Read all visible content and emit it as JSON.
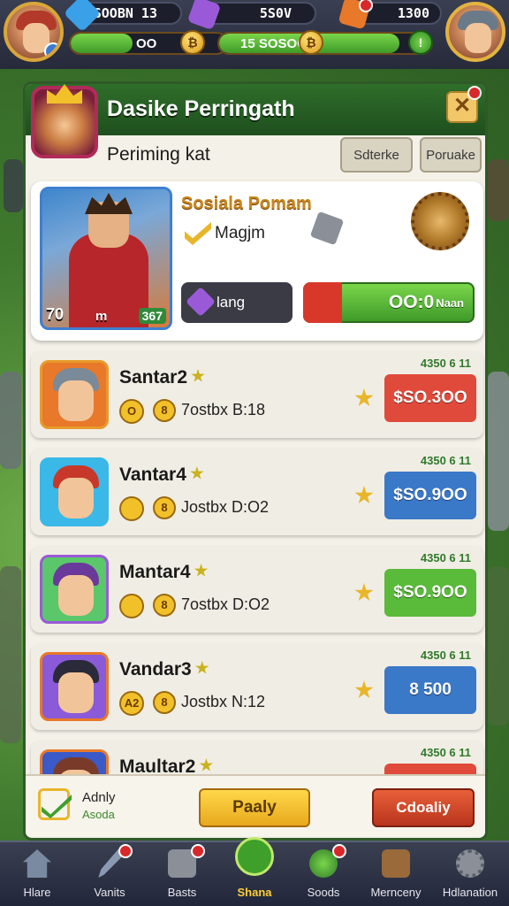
{
  "topbar": {
    "resource1": "SOOBN 13",
    "resource2": "5S0V",
    "resource3": "1300",
    "bar_left_value": "OO",
    "bar_mid_value": "15 SOSOO",
    "bar_left_fill": 0.4,
    "bar_right_fill": 0.85
  },
  "panel": {
    "title": "Dasike Perringath",
    "subtitle": "Periming kat",
    "tab1": "Sdterke",
    "tab2": "Poruake",
    "close_label": "✕"
  },
  "featured": {
    "level": "70",
    "mid_label": "m",
    "power": "367",
    "title": "Sosiala Pomam",
    "subtitle": "Magjm",
    "dark_button_label": "lang",
    "green_button_label": "OO:0",
    "green_button_suffix": "Naan"
  },
  "rows": [
    {
      "name": "Santar2",
      "id": "4350 6 11",
      "icon1": "O",
      "icon2": "8",
      "stat": "7ostbx  B:18",
      "price": "$SO.3OO",
      "btn_color": "#e04a3a"
    },
    {
      "name": "Vantar4",
      "id": "4350 6 11",
      "icon1": "",
      "icon2": "8",
      "stat": "Jostbx  D:O2",
      "price": "$SO.9OO",
      "btn_color": "#3a78c8"
    },
    {
      "name": "Mantar4",
      "id": "4350 6 11",
      "icon1": "",
      "icon2": "8",
      "stat": "7ostbx  D:O2",
      "price": "$SO.9OO",
      "btn_color": "#5aba3a"
    },
    {
      "name": "Vandar3",
      "id": "4350 6 11",
      "icon1": "A2",
      "icon2": "8",
      "stat": "Jostbx  N:12",
      "price": "8 500",
      "btn_color": "#3a78c8"
    },
    {
      "name": "Maultar2",
      "id": "4350 6 11",
      "icon1": "",
      "icon2": "",
      "stat": "",
      "price": "",
      "btn_color": "#e04a3a"
    }
  ],
  "bottom": {
    "label": "Adnly",
    "sub": "Asoda",
    "yellow_button": "Paaly",
    "orange_button": "Cdoaliy"
  },
  "nav": [
    {
      "label": "Hlare",
      "icon": "home-icon"
    },
    {
      "label": "Vanits",
      "icon": "sword-icon"
    },
    {
      "label": "Basts",
      "icon": "chest-icon"
    },
    {
      "label": "Shana",
      "icon": "shield-icon"
    },
    {
      "label": "Soods",
      "icon": "orb-icon"
    },
    {
      "label": "Mernceny",
      "icon": "crate-icon"
    },
    {
      "label": "Hdlanation",
      "icon": "gear-icon"
    }
  ]
}
